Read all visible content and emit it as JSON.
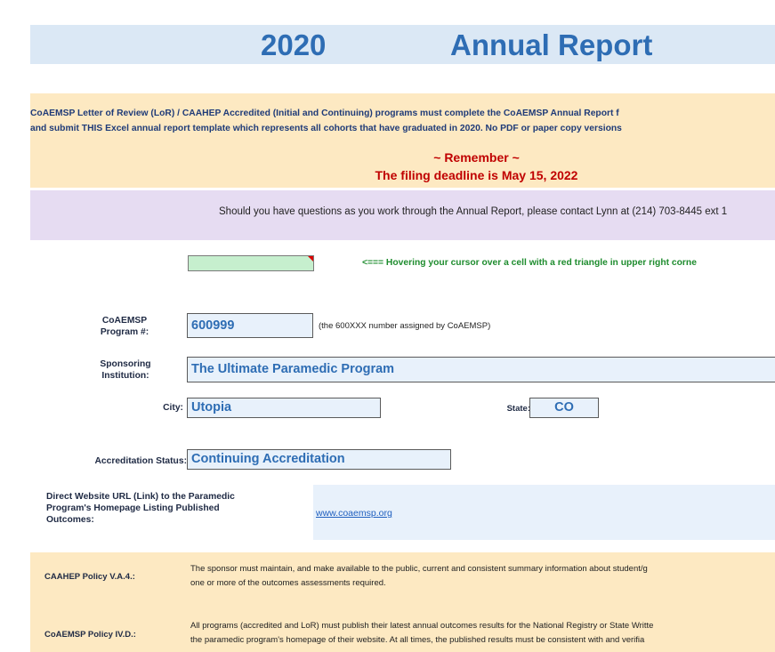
{
  "title": {
    "year": "2020",
    "name": "Annual Report"
  },
  "notice": {
    "line1": "CoAEMSP Letter of Review (LoR) / CAAHEP Accredited (Initial and Continuing) programs must complete the CoAEMSP Annual Report f",
    "line2": "and submit THIS Excel annual report template which represents all cohorts that have graduated in 2020.  No PDF or paper copy versions",
    "remember": "~ Remember ~",
    "deadline": "The filing deadline is May 15, 2022"
  },
  "contact": {
    "text": "Should you have questions as you work through the Annual Report, please contact Lynn at (214) 703-8445 ext 1"
  },
  "hint": {
    "text": "<=== Hovering your cursor over a cell with a red triangle in upper right corne"
  },
  "program": {
    "label_line1": "CoAEMSP",
    "label_line2": "Program #:",
    "value": "600999",
    "note": "(the 600XXX number assigned by CoAEMSP)"
  },
  "sponsor": {
    "label_line1": "Sponsoring",
    "label_line2": "Institution:",
    "value": "The Ultimate Paramedic Program"
  },
  "city": {
    "label": "City:",
    "value": "Utopia"
  },
  "state": {
    "label": "State:",
    "value": "CO"
  },
  "accreditation": {
    "label": "Accreditation Status:",
    "value": "Continuing Accreditation"
  },
  "website": {
    "label_line1": "Direct Website URL (Link) to the Paramedic",
    "label_line2": "Program's Homepage Listing Published",
    "label_line3": "Outcomes:",
    "url": "www.coaemsp.org"
  },
  "policies": [
    {
      "label": "CAAHEP Policy V.A.4.:",
      "line1": "The sponsor must maintain, and make available to the public, current and consistent summary information about student/g",
      "line2": "one or more of the outcomes assessments required."
    },
    {
      "label": "CoAEMSP Policy IV.D.:",
      "line1": "All programs (accredited and LoR) must publish their latest annual outcomes results for the National Registry or State Writte",
      "line2": "the paramedic program's homepage of their website.  At all times, the published results must be consistent with and verifia"
    }
  ],
  "colors": {
    "title_blue": "#2e6db4",
    "notice_bg": "#fde9c2",
    "contact_bg": "#e6dcf2",
    "deadline_red": "#c00000",
    "hint_green": "#1e8c2e"
  }
}
